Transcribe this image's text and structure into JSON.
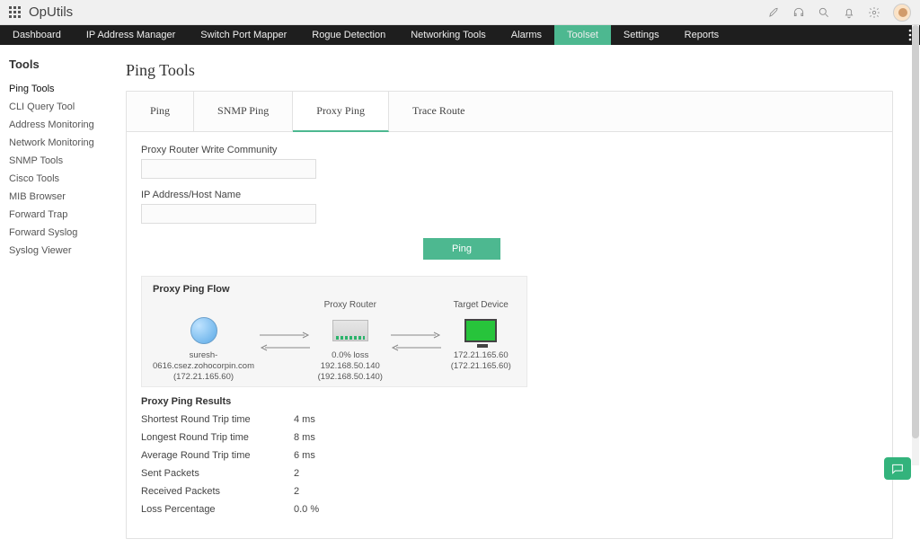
{
  "brand": "OpUtils",
  "nav": {
    "items": [
      "Dashboard",
      "IP Address Manager",
      "Switch Port Mapper",
      "Rogue Detection",
      "Networking Tools",
      "Alarms",
      "Toolset",
      "Settings",
      "Reports"
    ],
    "active": "Toolset"
  },
  "sidebar": {
    "title": "Tools",
    "items": [
      "Ping Tools",
      "CLI Query Tool",
      "Address Monitoring",
      "Network Monitoring",
      "SNMP Tools",
      "Cisco Tools",
      "MIB Browser",
      "Forward Trap",
      "Forward Syslog",
      "Syslog Viewer"
    ],
    "active": "Ping Tools"
  },
  "page": {
    "title": "Ping Tools",
    "tabs": [
      "Ping",
      "SNMP Ping",
      "Proxy Ping",
      "Trace Route"
    ],
    "active_tab": "Proxy Ping"
  },
  "form": {
    "community_label": "Proxy Router Write Community",
    "community_value": "",
    "host_label": "IP Address/Host Name",
    "host_value": "",
    "button": "Ping"
  },
  "flow": {
    "title": "Proxy Ping Flow",
    "router_title": "Proxy Router",
    "target_title": "Target Device",
    "source_host": "suresh-0616.csez.zohocorpin.com",
    "source_ip": "(172.21.165.60)",
    "router_loss": "0.0% loss 192.168.50.140 (192.168.50.140)",
    "target_ip": "172.21.165.60",
    "target_ip2": "(172.21.165.60)"
  },
  "results": {
    "title": "Proxy Ping Results",
    "rows": [
      {
        "label": "Shortest Round Trip time",
        "value": "4 ms"
      },
      {
        "label": "Longest Round Trip time",
        "value": "8 ms"
      },
      {
        "label": "Average Round Trip time",
        "value": "6 ms"
      },
      {
        "label": "Sent Packets",
        "value": "2"
      },
      {
        "label": "Received Packets",
        "value": "2"
      },
      {
        "label": "Loss Percentage",
        "value": "0.0 %"
      }
    ]
  }
}
